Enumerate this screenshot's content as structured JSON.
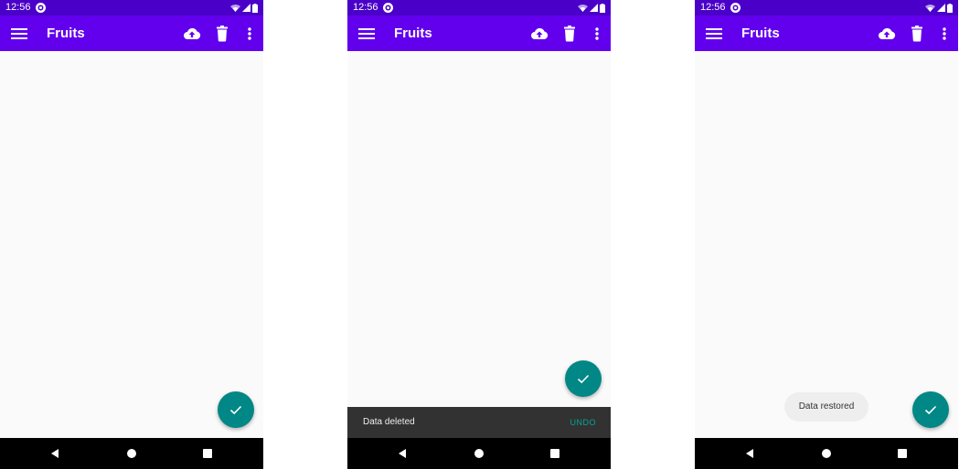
{
  "screens": [
    {
      "status": {
        "time": "12:56"
      },
      "app_bar": {
        "title": "Fruits"
      },
      "nav": [
        "back",
        "home",
        "recents"
      ]
    },
    {
      "status": {
        "time": "12:56"
      },
      "app_bar": {
        "title": "Fruits"
      },
      "snackbar": {
        "message": "Data deleted",
        "action": "UNDO"
      },
      "nav": [
        "back",
        "home",
        "recents"
      ]
    },
    {
      "status": {
        "time": "12:56"
      },
      "app_bar": {
        "title": "Fruits"
      },
      "toast": {
        "message": "Data restored"
      },
      "nav": [
        "back",
        "home",
        "recents"
      ]
    }
  ],
  "icons": {
    "menu": "menu-icon",
    "upload": "cloud-upload-icon",
    "delete": "trash-icon",
    "overflow": "more-vert-icon",
    "fab": "check-icon",
    "app_status": "app-indicator-icon",
    "wifi": "wifi-icon",
    "signal": "signal-icon",
    "battery": "battery-icon",
    "back": "nav-back-icon",
    "home": "nav-home-icon",
    "recents": "nav-recents-icon"
  },
  "colors": {
    "status_bar": "#4a00c8",
    "app_bar": "#6200ee",
    "fab": "#018786",
    "snackbar_bg": "#323232",
    "snackbar_action": "#03a69a",
    "toast_bg": "#eeeeee",
    "nav_bar": "#000000",
    "background": "#fafafa"
  }
}
